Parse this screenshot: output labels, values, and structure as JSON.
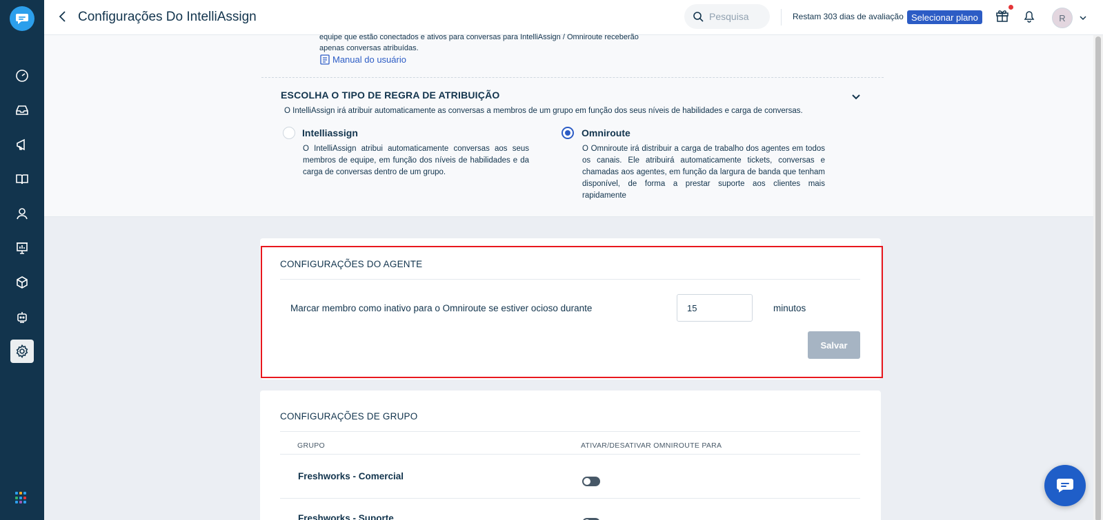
{
  "header": {
    "title": "Configurações Do IntelliAssign",
    "search_placeholder": "Pesquisa",
    "trial_text": "Restam 303 dias de avaliação",
    "plan_button": "Selecionar plano",
    "avatar_initial": "R"
  },
  "sidebar": {
    "items": [
      "dashboard",
      "inbox",
      "campaigns",
      "knowledge-base",
      "contacts",
      "reports",
      "products",
      "bots",
      "settings"
    ],
    "active": "settings"
  },
  "intro": {
    "text_line1": "equipe que estão conectados e ativos para conversas para IntelliAssign / Omniroute receberão",
    "text_line2": "apenas conversas atribuídas.",
    "manual_link": "Manual do usuário"
  },
  "rule_type": {
    "heading": "ESCOLHA O TIPO DE REGRA DE ATRIBUIÇÃO",
    "description": "O IntelliAssign irá atribuir automaticamente as conversas a membros de um grupo em função dos seus níveis de habilidades e carga de conversas.",
    "options": [
      {
        "title": "Intelliassign",
        "description": "O IntelliAssign atribui automaticamente conversas aos seus membros de equipe, em função dos níveis de habilidades e da carga de conversas dentro de um grupo.",
        "selected": false
      },
      {
        "title": "Omniroute",
        "description": "O Omniroute irá distribuir a carga de trabalho dos agentes em todos os canais. Ele atribuirá automaticamente tickets, conversas e chamadas aos agentes, em função da largura de banda que tenham disponível, de forma a prestar suporte aos clientes mais rapidamente",
        "selected": true
      }
    ]
  },
  "agent_settings": {
    "heading": "CONFIGURAÇÕES DO AGENTE",
    "label": "Marcar membro como inativo para o Omniroute se estiver ocioso durante",
    "value": "15",
    "unit": "minutos",
    "save_button": "Salvar"
  },
  "group_settings": {
    "heading": "CONFIGURAÇÕES DE GRUPO",
    "columns": [
      "GRUPO",
      "ATIVAR/DESATIVAR OMNIROUTE PARA"
    ],
    "rows": [
      {
        "name": "Freshworks - Comercial",
        "enabled": false
      },
      {
        "name": "Freshworks - Suporte",
        "enabled": false
      }
    ]
  },
  "colors": {
    "sidebar_bg": "#12344d",
    "accent": "#2c5cc5",
    "highlight_border": "#e8171d",
    "chat_bubble": "#1f5ec8"
  }
}
